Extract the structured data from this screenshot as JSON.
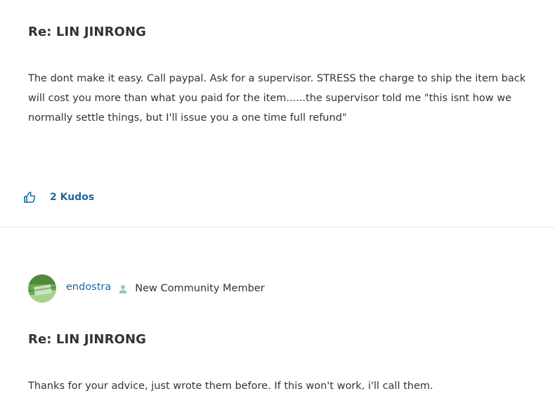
{
  "posts": [
    {
      "title": "Re: LIN JINRONG",
      "body": "The dont make it easy. Call paypal. Ask for a supervisor. STRESS the charge to ship the item back will cost you more than what you paid for the item......the supervisor told me \"this isnt how we normally settle things, but I'll issue you a one time full refund\"",
      "kudos_label": "2 Kudos",
      "kudos_icon": "thumbs-up-icon"
    },
    {
      "author": "endostra",
      "rank_icon": "user-icon",
      "rank_label": "New Community Member",
      "title": "Re: LIN JINRONG",
      "body": "Thanks for your advice, just wrote them before. If this won't work, i'll call them."
    }
  ],
  "colors": {
    "link": "#1a6b9e",
    "text": "#333333",
    "rank_icon": "#8ccfb4",
    "divider": "#e6e6e6"
  }
}
